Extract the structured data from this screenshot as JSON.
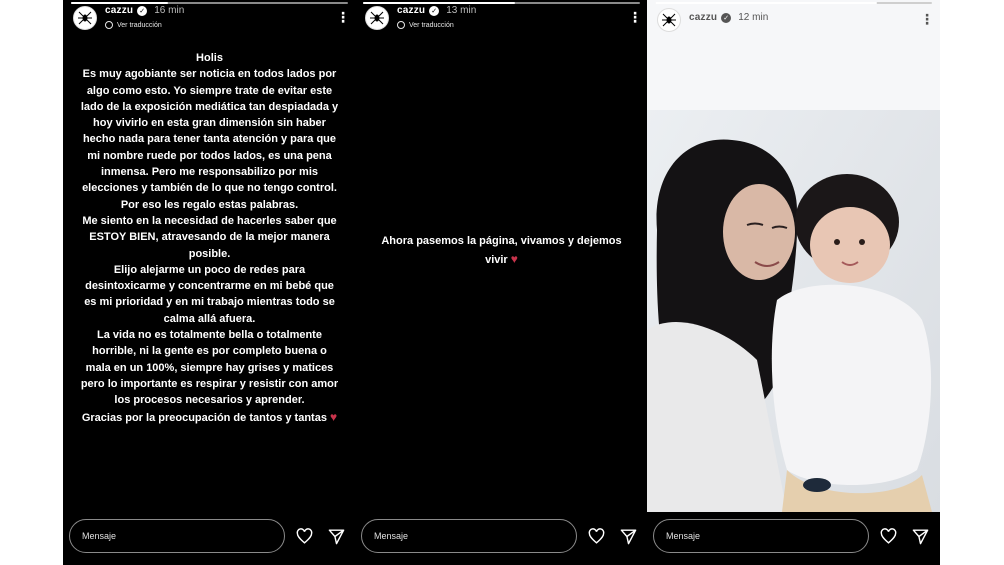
{
  "stories": [
    {
      "username": "cazzu",
      "time": "16 min",
      "translate_label": "Ver traducción",
      "text_paragraphs": [
        "Holis",
        "Es muy agobiante ser noticia en todos lados por algo como esto. Yo siempre trate de evitar este lado de la exposición mediática tan despiadada y hoy vivirlo en esta gran dimensión sin haber hecho nada para tener tanta atención y para que mi nombre ruede por todos lados, es una pena inmensa. Pero me responsabilizo por mis elecciones y también de lo que no tengo control. Por eso les regalo estas palabras.",
        "Me siento en la necesidad de hacerles saber que ESTOY BIEN, atravesando de la mejor manera posible.",
        "Elijo alejarme un poco de redes para desintoxicarme y concentrarme en mi bebé que es mi prioridad y en mi trabajo mientras todo se calma allá afuera.",
        "La vida no es totalmente bella o totalmente horrible, ni la gente es por completo buena o mala en un 100%, siempre hay grises y matices pero lo importante es respirar y resistir con amor los procesos necesarios y aprender.",
        "Gracias por la preocupación de tantos y tantas"
      ],
      "heart": "♥",
      "message_placeholder": "Mensaje",
      "progress": 0.35
    },
    {
      "username": "cazzu",
      "time": "13 min",
      "translate_label": "Ver traducción",
      "text": "Ahora pasemos la página, vivamos y dejemos vivir",
      "heart": "♥",
      "message_placeholder": "Mensaje",
      "progress": 0.55
    },
    {
      "username": "cazzu",
      "time": "12 min",
      "message_placeholder": "Mensaje",
      "progress": 0.8
    }
  ],
  "icons": {
    "avatar": "spider-logo-icon",
    "verified": "verified-icon",
    "more": "more-vertical-icon",
    "like": "heart-outline-icon",
    "share": "send-icon"
  },
  "colors": {
    "background": "#000000",
    "heart": "#c8334b",
    "text": "#ffffff"
  }
}
